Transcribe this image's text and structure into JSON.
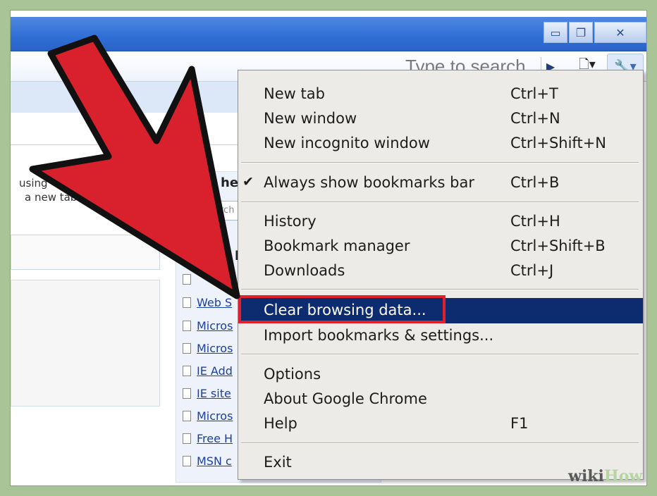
{
  "window": {
    "minimize_glyph": "▭",
    "restore_glyph": "❐",
    "close_glyph": "✕"
  },
  "toolbar": {
    "search_placeholder": "Type to search",
    "go_glyph": "▶",
    "page_glyph": "🗋▾",
    "wrench_glyph": "🔧▾"
  },
  "page": {
    "snippet_1": "using",
    "snippet_2": "a new tab",
    "right_heading": "he",
    "right_input_hint": "rch",
    "right_subheading": "b",
    "links": [
      "Web S",
      "Micros",
      "Micros",
      "IE Add",
      "IE site",
      "Micros",
      "Free H",
      "MSN c"
    ]
  },
  "menu": {
    "items": [
      {
        "label": "New tab",
        "shortcut": "Ctrl+T"
      },
      {
        "label": "New window",
        "shortcut": "Ctrl+N"
      },
      {
        "label": "New incognito window",
        "shortcut": "Ctrl+Shift+N"
      },
      {
        "label": "Always show bookmarks bar",
        "shortcut": "Ctrl+B",
        "checked": true
      },
      {
        "label": "History",
        "shortcut": "Ctrl+H"
      },
      {
        "label": "Bookmark manager",
        "shortcut": "Ctrl+Shift+B"
      },
      {
        "label": "Downloads",
        "shortcut": "Ctrl+J"
      },
      {
        "label": "Clear browsing data...",
        "shortcut": ""
      },
      {
        "label": "Import bookmarks & settings...",
        "shortcut": ""
      },
      {
        "label": "Options",
        "shortcut": ""
      },
      {
        "label": "About Google Chrome",
        "shortcut": ""
      },
      {
        "label": "Help",
        "shortcut": "F1"
      },
      {
        "label": "Exit",
        "shortcut": ""
      }
    ],
    "check_glyph": "✔"
  },
  "watermark": {
    "part1": "wiki",
    "part2": "How"
  },
  "colors": {
    "arrow": "#d8212d",
    "highlight": "#0d2c6f",
    "callout": "#e0202b"
  }
}
